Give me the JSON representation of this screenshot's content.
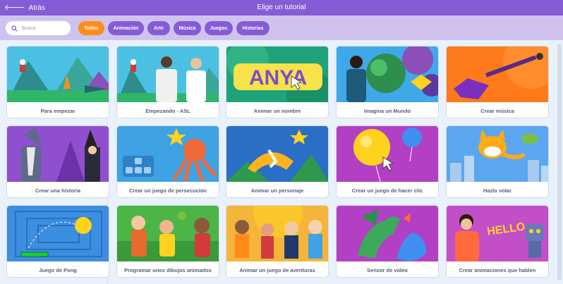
{
  "header": {
    "back_label": "Atrás",
    "title": "Elige un tutorial"
  },
  "filters": {
    "search_placeholder": "Busca",
    "chips": [
      "Todos",
      "Animación",
      "Arte",
      "Música",
      "Juegos",
      "Historias"
    ],
    "active": "Todos"
  },
  "tutorials": [
    "Para empezar",
    "Empezando - ASL",
    "Animar un nombre",
    "Imagina un Mundo",
    "Crear música",
    "Crear una historia",
    "Crear un juego de persecución",
    "Animar un personaje",
    "Crear un juego de hacer clic",
    "Hazlo volar",
    "Juego de Pong",
    "Programar unos dibujos animados",
    "Animar un juego de aventuras",
    "Sensor de video",
    "Crear animaciones que hablen"
  ],
  "thumb_text": {
    "anya": "ANYA",
    "hello": "HELLO"
  },
  "colors": {
    "header": "#855cd6",
    "filterbar": "#cfc3ee",
    "chip": "#855cd6",
    "chip_active": "#ff8c1a",
    "background": "#e9f1fc",
    "label_text": "#575e75"
  }
}
